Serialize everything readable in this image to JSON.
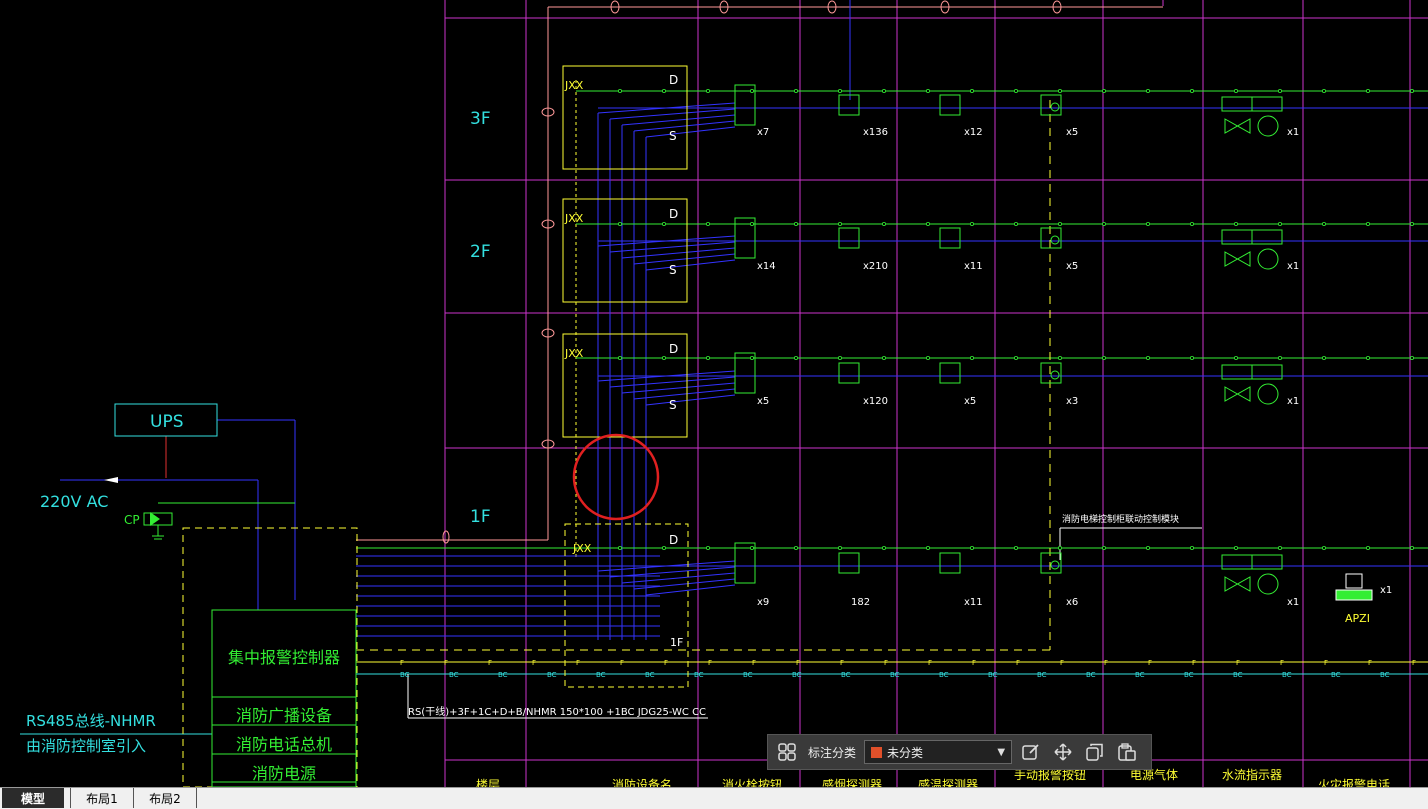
{
  "floors": [
    "3F",
    "2F",
    "1F"
  ],
  "panel": {
    "junction_label": "JXX",
    "d_label": "D",
    "s_label": "S",
    "first_floor_box_label": "1F"
  },
  "left_system": {
    "ups_label": "UPS",
    "ac_label": "220V AC",
    "cp_label": "CP",
    "controller_title": "集中报警控制器",
    "controller_items": [
      "消防广播设备",
      "消防电话总机",
      "消防电源"
    ],
    "bus_label": "RS485总线-NHMR",
    "bus_source": "由消防控制室引入"
  },
  "cable_label": "RS(干线)+3F+1C+D+B/NHMR 150*100 +1BC JDG25-WC CC",
  "annotation_note": "消防电梯控制柜联动控制模块",
  "equipment_counts": {
    "3F": [
      "x7",
      "x136",
      "x12",
      "x5",
      "x1"
    ],
    "2F": [
      "x14",
      "x210",
      "x11",
      "x5",
      "x1"
    ],
    "mid": [
      "x5",
      "x120",
      "x5",
      "x3",
      "x1"
    ],
    "1F": [
      "x9",
      "182",
      "x11",
      "x6",
      "x1",
      "x1"
    ]
  },
  "apzi_label": "APZI",
  "bottom_headers": [
    "楼层",
    "消防设备名",
    "消火栓按钮",
    "感烟探测器",
    "感温探测器",
    "手动报警按钮",
    "电源气体",
    "水流指示器",
    "火灾报警电话"
  ],
  "bc_label": "BC",
  "f_label": "F",
  "annotation_toolbar": {
    "category_label": "标注分类",
    "category_value": "未分类",
    "icons": [
      "grid-icon",
      "edit-icon",
      "move-icon",
      "copy-icon",
      "paste-icon"
    ]
  },
  "tabs": [
    "模型",
    "布局1",
    "布局2"
  ],
  "colors": {
    "magenta_grid": "#cc33cc",
    "green_wire": "#33ee33",
    "blue_wire": "#3333ff",
    "yellow": "#ffff33",
    "cyan": "#33e0e0",
    "highlight_circle": "#e02020",
    "category_swatch": "#e0502a"
  }
}
